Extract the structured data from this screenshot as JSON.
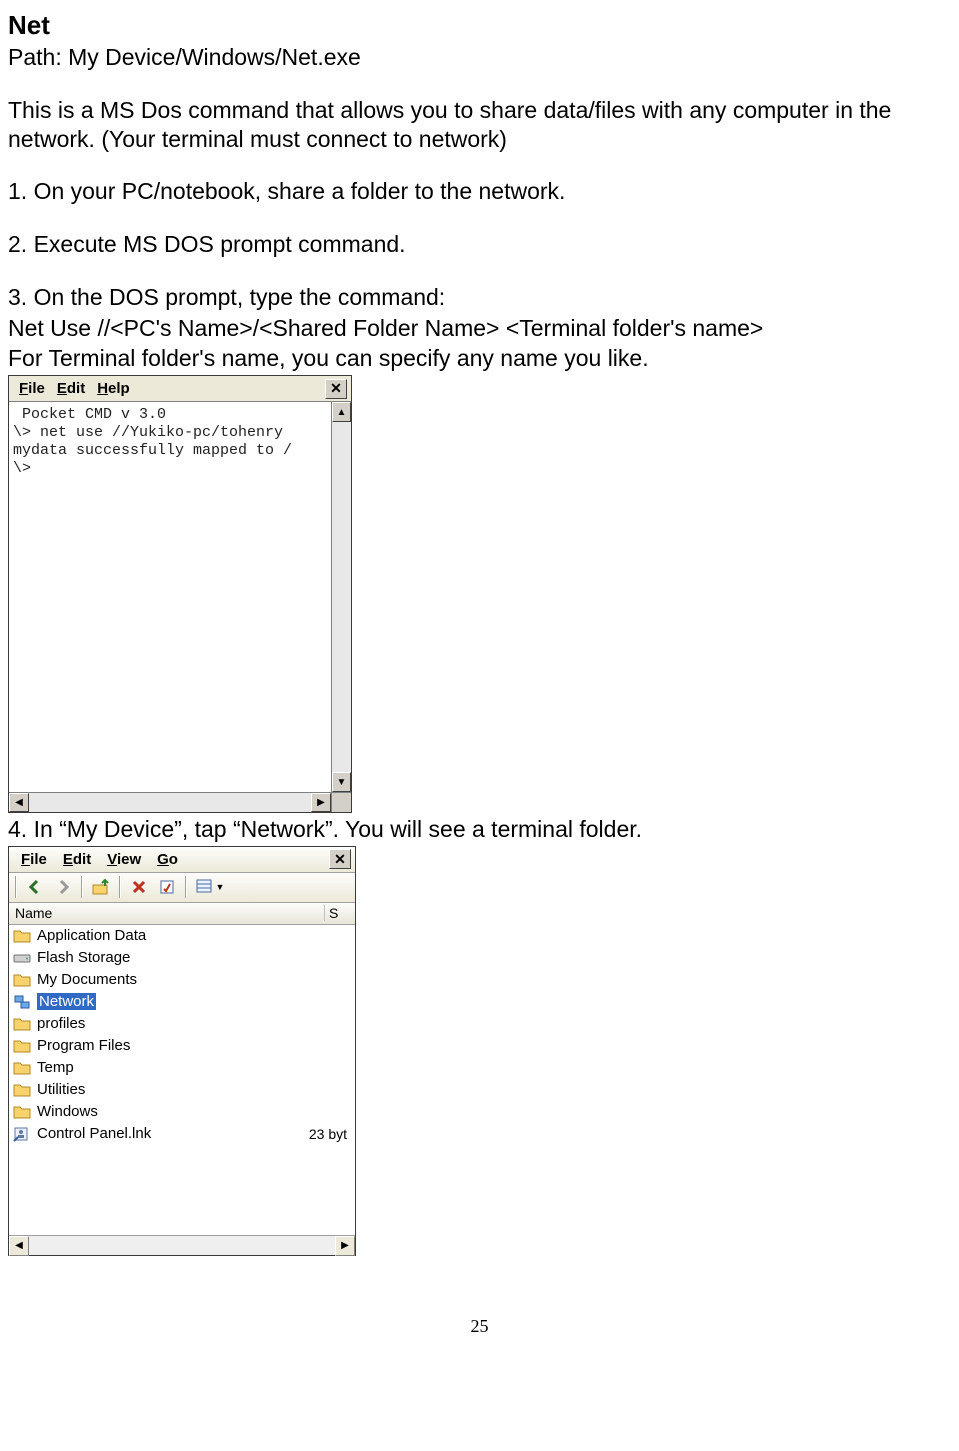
{
  "doc": {
    "title": "Net",
    "path": "Path: My Device/Windows/Net.exe",
    "intro": "This is a MS Dos command that allows you to share data/files with any computer in the network. (Your terminal must connect to network)",
    "step1": "1. On your PC/notebook, share a folder to the network.",
    "step2": "2. Execute MS DOS prompt command.",
    "step3a": "3. On the DOS prompt, type the command:",
    "step3b": "Net Use //<PC's Name>/<Shared Folder Name> <Terminal folder's name>",
    "step3c": "For Terminal folder's name, you can specify any name you like.",
    "step4": "4. In “My Device”, tap “Network”. You will see a terminal folder.",
    "page_number": "25"
  },
  "cmd": {
    "menu": {
      "file": "File",
      "edit": "Edit",
      "help": "Help"
    },
    "lines": " Pocket CMD v 3.0\n\\> net use //Yukiko-pc/tohenry\nmydata successfully mapped to /\n\\>"
  },
  "explorer": {
    "menu": {
      "file": "File",
      "edit": "Edit",
      "view": "View",
      "go": "Go"
    },
    "header": {
      "name": "Name",
      "size": "S"
    },
    "items": [
      {
        "name": "Application Data",
        "type": "folder",
        "size": ""
      },
      {
        "name": "Flash Storage",
        "type": "drive",
        "size": ""
      },
      {
        "name": "My Documents",
        "type": "folder",
        "size": ""
      },
      {
        "name": "Network",
        "type": "network",
        "size": "",
        "selected": true
      },
      {
        "name": "profiles",
        "type": "folder",
        "size": ""
      },
      {
        "name": "Program Files",
        "type": "folder",
        "size": ""
      },
      {
        "name": "Temp",
        "type": "folder",
        "size": ""
      },
      {
        "name": "Utilities",
        "type": "folder",
        "size": ""
      },
      {
        "name": "Windows",
        "type": "folder",
        "size": ""
      },
      {
        "name": "Control Panel.lnk",
        "type": "link",
        "size": "23 byt"
      }
    ]
  }
}
